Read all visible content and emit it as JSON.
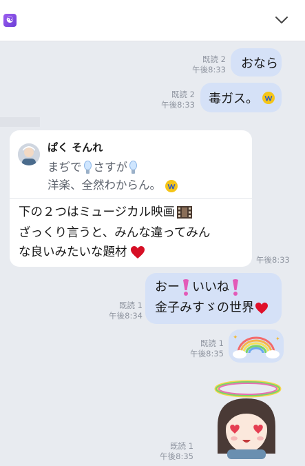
{
  "header": {
    "app_icon": "yin-yang-icon",
    "collapse_icon": "chevron-down-icon"
  },
  "messages": [
    {
      "id": "m1",
      "text": "おなら",
      "read": "既読 2",
      "time": "午後8:33"
    },
    {
      "id": "m2",
      "text": "毒ガス。",
      "emoji": "laughing-face-icon",
      "read": "既読 2",
      "time": "午後8:33"
    },
    {
      "id": "m3",
      "quote": {
        "author": "ぱく そんれ",
        "line1_a": "まぢで",
        "line1_b": "さすが",
        "line2": "洋楽、全然わからん。"
      },
      "lines": [
        "下の２つはミュージカル映画",
        "ざっくり言うと、みんな違ってみん",
        "な良いみたいな題材"
      ],
      "time": "午後8:33"
    },
    {
      "id": "m4",
      "line1_a": "おー",
      "line1_b": "いいね",
      "line2": "金子みすゞの世界",
      "read": "既読 1",
      "time": "午後8:34"
    },
    {
      "id": "m5",
      "sticker": "rainbow-sticker",
      "read": "既読 1",
      "time": "午後8:35"
    },
    {
      "id": "m6",
      "sticker": "halo-girl-sticker",
      "read": "既読 1",
      "time": "午後8:35"
    }
  ],
  "colors": {
    "background": "#e8ebf0",
    "bubble_out": "#d5e1f7",
    "bubble_in": "#ffffff",
    "meta_text": "#8f95a0",
    "heart": "#e0102a"
  }
}
